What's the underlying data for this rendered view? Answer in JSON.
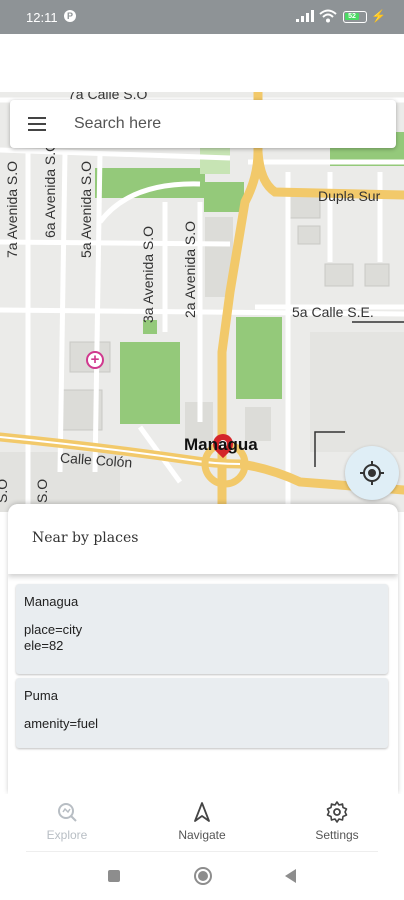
{
  "status_bar": {
    "time": "12:11",
    "battery": "52"
  },
  "search": {
    "placeholder": "Search here"
  },
  "map": {
    "labels": {
      "street_top": "7a Calle S.O",
      "dupla_sur": "Dupla Sur",
      "calle_5a": "5a Calle S.E.",
      "calle_colon": "Calle Colón",
      "avenida_7a": "7a Avenida S.O",
      "avenida_6a": "6a Avenida S.O",
      "avenida_5a": "5a Avenida S.O",
      "avenida_3a": "3a Avenida S.O",
      "avenida_2a": "2a Avenida S.O",
      "left_so": "S.O",
      "left_so2": "S.O"
    },
    "city": "Managua",
    "colors": {
      "background": "#ebebe9",
      "park": "#94c97a",
      "highway": "#f2c96a",
      "road": "#ffffff"
    }
  },
  "bottom_sheet": {
    "title": "Near by places",
    "places": [
      {
        "name": "Managua",
        "tags": [
          "place=city",
          "ele=82"
        ]
      },
      {
        "name": "Puma",
        "tags": [
          "amenity=fuel"
        ]
      }
    ]
  },
  "bottom_nav": {
    "items": [
      {
        "label": "Explore",
        "icon": "explore-icon",
        "active": true
      },
      {
        "label": "Navigate",
        "icon": "navigate-icon",
        "active": false
      },
      {
        "label": "Settings",
        "icon": "gear-icon",
        "active": false
      }
    ]
  }
}
